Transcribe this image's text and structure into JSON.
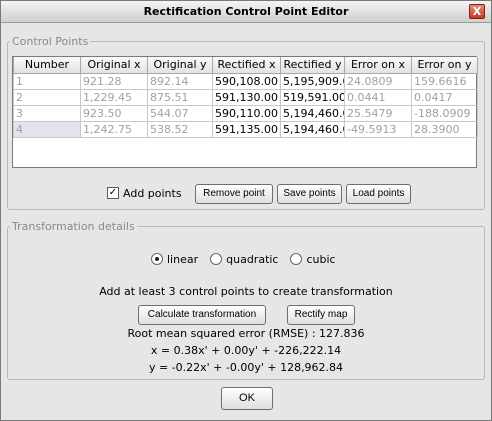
{
  "window": {
    "title": "Rectification Control Point Editor",
    "close_label": "X"
  },
  "control_points": {
    "legend": "Control Points",
    "columns": [
      "Number",
      "Original x",
      "Original y",
      "Rectified x",
      "Rectified y",
      "Error on x",
      "Error on y"
    ],
    "rows": [
      {
        "number": "1",
        "orig_x": "921.28",
        "orig_y": "892.14",
        "rect_x": "590,108.00",
        "rect_y": "5,195,909.0",
        "err_x": "24.0809",
        "err_y": "159.6616"
      },
      {
        "number": "2",
        "orig_x": "1,229.45",
        "orig_y": "875.51",
        "rect_x": "591,130.00",
        "rect_y": "519,591.00",
        "err_x": "0.0441",
        "err_y": "0.0417"
      },
      {
        "number": "3",
        "orig_x": "923.50",
        "orig_y": "544.07",
        "rect_x": "590,110.00",
        "rect_y": "5,194,460.0",
        "err_x": "25.5479",
        "err_y": "-188.0909"
      },
      {
        "number": "4",
        "orig_x": "1,242.75",
        "orig_y": "538.52",
        "rect_x": "591,135.00",
        "rect_y": "5,194,460.0",
        "err_x": "-49.5913",
        "err_y": "28.3900"
      }
    ],
    "add_points_label": "Add points",
    "add_points_checked": true,
    "remove_label": "Remove point",
    "save_label": "Save points",
    "load_label": "Load points"
  },
  "transformation": {
    "legend": "Transformation details",
    "options": [
      "linear",
      "quadratic",
      "cubic"
    ],
    "selected": "linear",
    "info": "Add at least 3 control points to create transformation",
    "calculate_label": "Calculate transformation",
    "rectify_label": "Rectify map",
    "rmse": "Root mean squared error (RMSE) : 127.836",
    "eq_x": "x = 0.38x' + 0.00y' + -226,222.14",
    "eq_y": "y = -0.22x' + -0.00y' + 128,962.84"
  },
  "ok_label": "OK"
}
